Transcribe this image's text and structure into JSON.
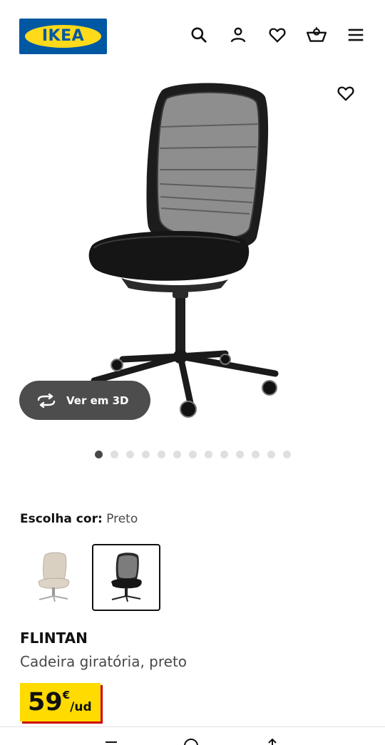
{
  "header": {
    "logo_text": "IKEA",
    "icons": [
      "search-icon",
      "account-icon",
      "favourites-icon",
      "cart-icon",
      "menu-icon"
    ]
  },
  "hero": {
    "favourite_icon": "heart-icon",
    "view_3d": {
      "label": "Ver em 3D",
      "icon": "rotate-3d-icon"
    },
    "carousel": {
      "total": 13,
      "active": 1
    }
  },
  "colour": {
    "label": "Escolha cor:",
    "value": "Preto",
    "options": [
      {
        "name": "beige",
        "selected": false
      },
      {
        "name": "preto",
        "selected": true
      }
    ]
  },
  "product": {
    "name": "FLINTAN",
    "description": "Cadeira giratória, preto",
    "price": {
      "integer": "59",
      "currency": "€",
      "unit": "/ud"
    }
  },
  "colors": {
    "brand_blue": "#0058a3",
    "brand_yellow": "#ffda1a",
    "price_tag": "#ffdb00",
    "price_shadow": "#cc0008",
    "button_3d_bg": "#4d4d4d"
  }
}
